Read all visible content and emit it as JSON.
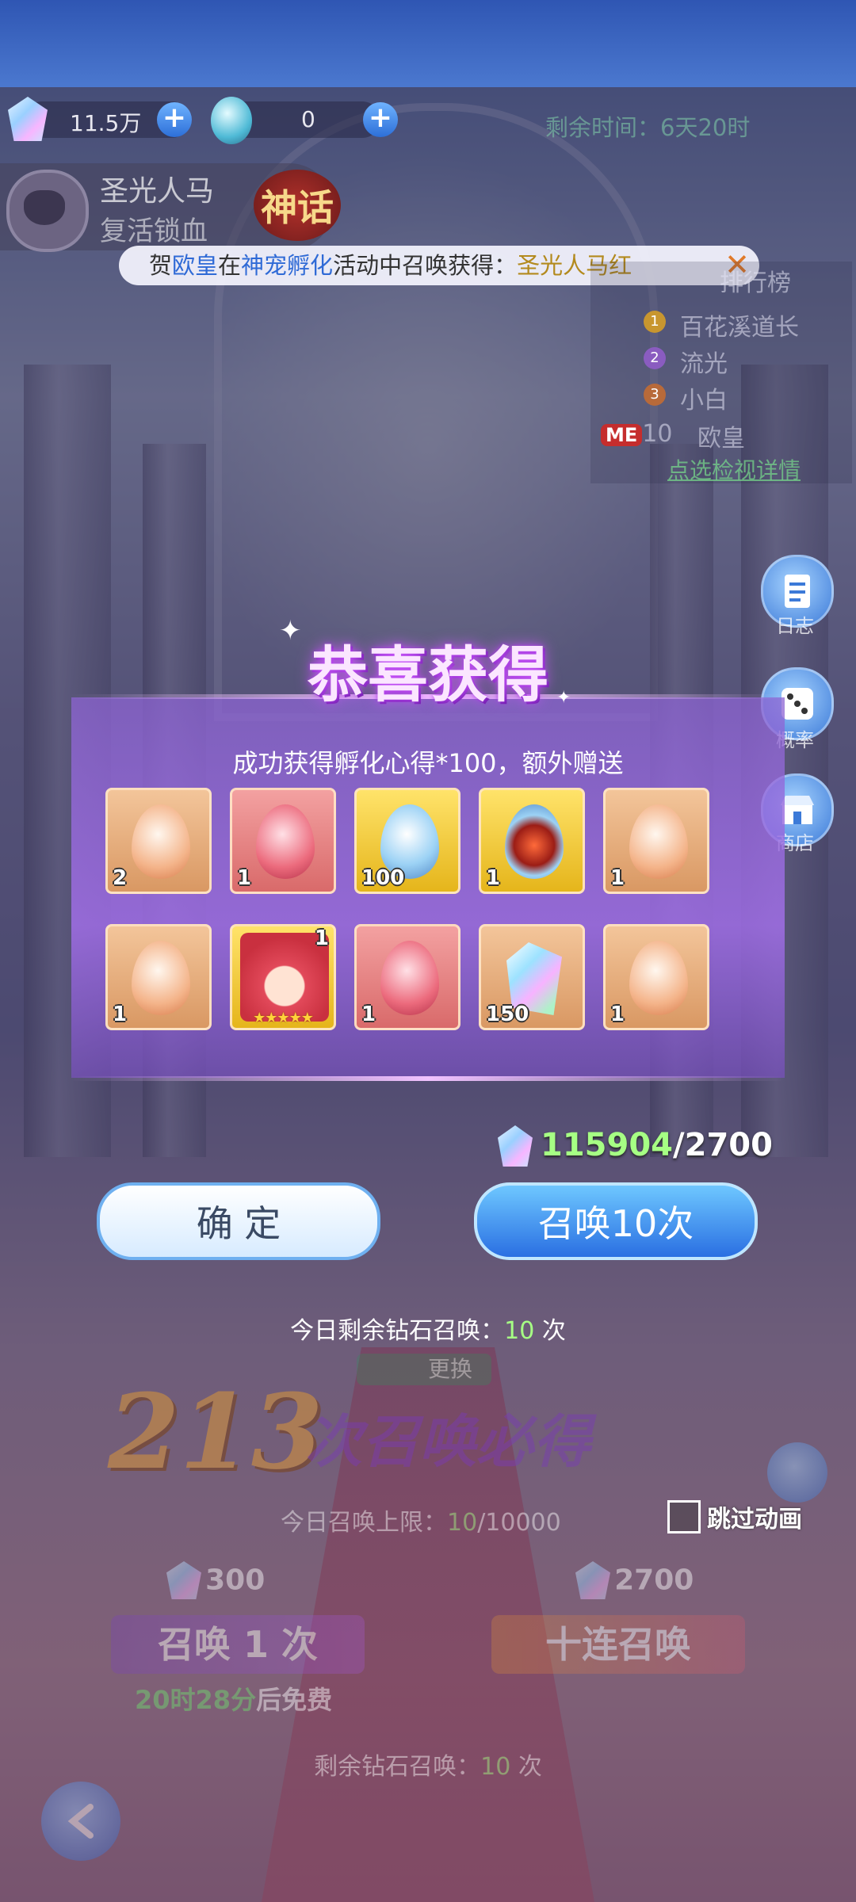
{
  "currency": {
    "gems": "11.5万",
    "eggs": "0"
  },
  "timer": {
    "label": "剩余时间：",
    "value": "6天20时"
  },
  "pet": {
    "name": "圣光人马",
    "status": "复活锁血",
    "rarity": "神话"
  },
  "marquee": {
    "prefix": "贺",
    "player": "欧皇",
    "mid1": "在",
    "event": "神宠孵化",
    "mid2": "活动中召唤获得：",
    "reward": "圣光人马红"
  },
  "ranking": {
    "title": "排行榜",
    "entries": [
      {
        "rank": "1",
        "name": "百花溪道长"
      },
      {
        "rank": "2",
        "name": "流光"
      },
      {
        "rank": "3",
        "name": "小白"
      }
    ],
    "me_badge": "ME",
    "me_rank": "10",
    "me_name": "欧皇",
    "detail_link": "点选检视详情"
  },
  "side_buttons": {
    "log": "日志",
    "probability": "概率",
    "shop": "商店"
  },
  "result": {
    "title": "恭喜获得",
    "subtitle": "成功获得孵化心得*100，额外赠送",
    "items": [
      {
        "icon": "orange-egg",
        "count": "2"
      },
      {
        "icon": "red-egg",
        "count": "1"
      },
      {
        "icon": "angel-egg",
        "count": "100"
      },
      {
        "icon": "fire-egg",
        "count": "1"
      },
      {
        "icon": "orange-egg",
        "count": "1"
      },
      {
        "icon": "orange-egg",
        "count": "1"
      },
      {
        "icon": "red-hair-girl",
        "count": "1",
        "stars": "★★★★★"
      },
      {
        "icon": "red-egg",
        "count": "1"
      },
      {
        "icon": "diamond-crystal",
        "count": "150"
      },
      {
        "icon": "orange-egg",
        "count": "1"
      }
    ]
  },
  "balance": {
    "current": "115904",
    "cost": "/2700"
  },
  "buttons": {
    "confirm": "确 定",
    "summon10": "召唤10次"
  },
  "today_remaining": {
    "label": "今日剩余钻石召唤：",
    "value": "10",
    "unit": " 次"
  },
  "guarantee": {
    "swap": "更换",
    "number": "213",
    "text": "次召唤必得"
  },
  "limit": {
    "label": "今日召唤上限：",
    "value": "10",
    "max": "/10000"
  },
  "skip_anim": "跳过动画",
  "summon_one": {
    "cost": "300",
    "label": "召唤 1 次",
    "free_time": "20时28分",
    "free_suffix": "后免费"
  },
  "summon_ten": {
    "cost": "2700",
    "label": "十连召唤"
  },
  "remaining_bottom": {
    "label": "剩余钻石召唤：",
    "value": "10",
    "unit": " 次"
  },
  "colors": {
    "accent_green": "#a6ff84",
    "title_purple": "#d25cff",
    "button_blue": "#2a6fe2"
  }
}
